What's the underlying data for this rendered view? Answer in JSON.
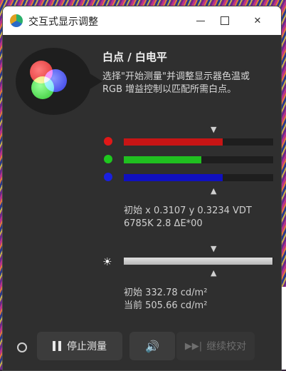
{
  "window": {
    "title": "交互式显示调整"
  },
  "icons": {
    "app": "app-logo-icon",
    "minimize": "minimize-icon",
    "maximize": "maximize-icon",
    "close": "close-icon",
    "color_balance": "rgb-circles-icon",
    "brightness": "sun-icon",
    "pause": "pause-icon",
    "speaker": "speaker-icon",
    "skip": "skip-forward-icon",
    "arrow_down": "▼",
    "arrow_up": "▲",
    "close_glyph": "✕",
    "sun_glyph": "☀",
    "speaker_glyph": "🔊",
    "skip_glyph": "▶▶|"
  },
  "main": {
    "heading": "白点 / 白电平",
    "instruction": "选择\"开始测量\"并调整显示器色温或\nRGB 增益控制以匹配所需白点。"
  },
  "colors": {
    "red": "#e01818",
    "green": "#1ec81e",
    "blue": "#1a20e0",
    "red_fill": "#c81515",
    "green_fill": "#20c020",
    "blue_fill": "#1010c0"
  },
  "rgb_levels": {
    "red": 0.66,
    "green": 0.52,
    "blue": 0.66
  },
  "white_point": {
    "line1": "初始 x 0.3107 y 0.3234 VDT",
    "line2": "6785K 2.8 ΔE*00"
  },
  "luminance": {
    "level": 0.995,
    "initial": "初始 332.78 cd/m²",
    "current": "当前 505.66 cd/m²"
  },
  "footer": {
    "stop_label": "停止测量",
    "continue_label": "继续校对"
  }
}
